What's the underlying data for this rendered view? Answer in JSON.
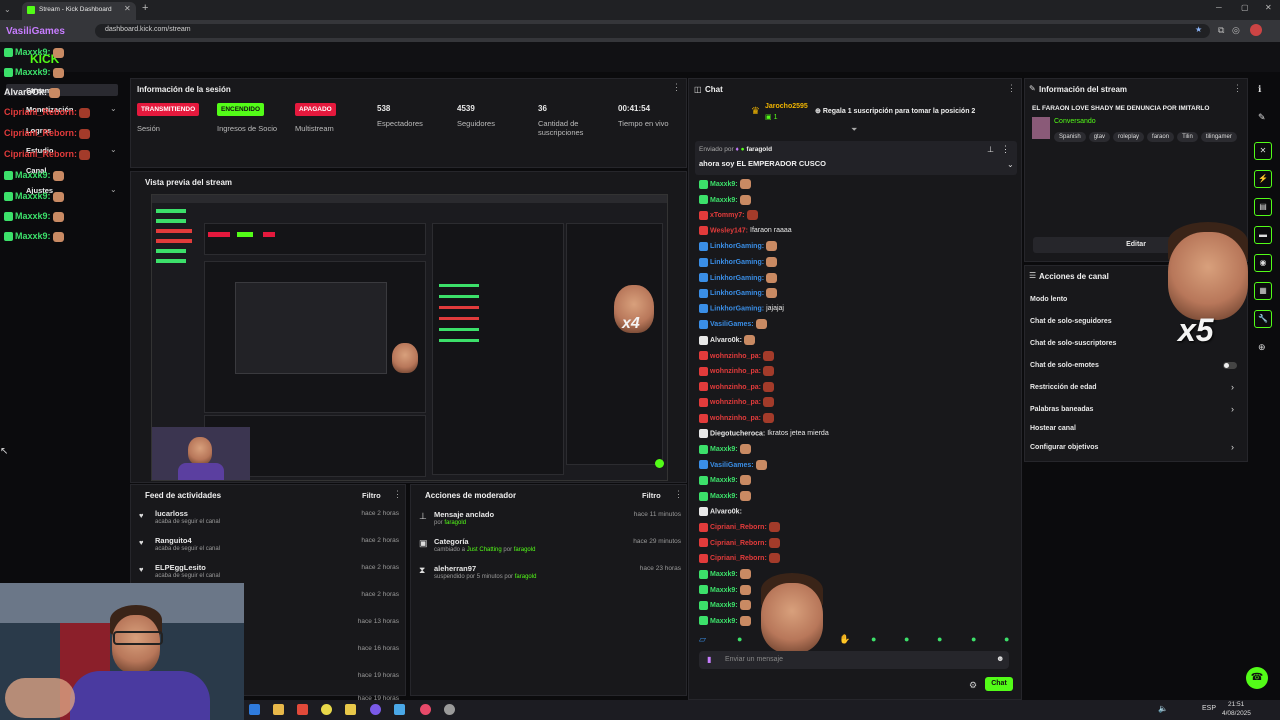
{
  "browser": {
    "tab_title": "Stream - Kick Dashboard",
    "new_tab_label": "+",
    "url": "dashboard.kick.com/stream"
  },
  "overlay": {
    "sidebar_chat_user": "VasiliGames",
    "kick_logo": "KICK"
  },
  "sidebar": {
    "overlay_users": [
      {
        "name": "Maxxk9:",
        "color": "#3ce06a"
      },
      {
        "name": "Maxxk9:",
        "color": "#3ce06a"
      },
      {
        "name": "AlvaroOk:",
        "color": "#e8e8e8"
      },
      {
        "name": "Cipriani_Reborn:",
        "color": "#e23b3b"
      },
      {
        "name": "Cipriani_Reborn:",
        "color": "#e23b3b"
      },
      {
        "name": "Cipriani_Reborn:",
        "color": "#e23b3b"
      },
      {
        "name": "Maxxk9:",
        "color": "#3ce06a"
      },
      {
        "name": "Maxxk9:",
        "color": "#3ce06a"
      },
      {
        "name": "Maxxk9:",
        "color": "#3ce06a"
      },
      {
        "name": "Maxxk9:",
        "color": "#3ce06a"
      }
    ],
    "items": [
      {
        "label": "Stream"
      },
      {
        "label": "Monetización"
      },
      {
        "label": "Logros"
      },
      {
        "label": "Estudio"
      },
      {
        "label": "Canal"
      },
      {
        "label": "Ajustes"
      }
    ]
  },
  "session": {
    "title": "Información de la sesión",
    "stats": [
      {
        "badge": "TRANSMITIENDO",
        "badge_color": "#e5193d",
        "label": "Sesión"
      },
      {
        "badge": "ENCENDIDO",
        "badge_color": "#53fc18",
        "label": "Ingresos de Socio"
      },
      {
        "badge": "APAGADO",
        "badge_color": "#e5193d",
        "label": "Multistream"
      },
      {
        "value": "538",
        "label": "Espectadores"
      },
      {
        "value": "4539",
        "label": "Seguidores"
      },
      {
        "value": "36",
        "label": "Cantidad de suscripciones"
      },
      {
        "value": "00:41:54",
        "label": "Tiempo en vivo"
      }
    ]
  },
  "preview": {
    "title": "Vista previa del stream",
    "overlay_multiplier": "x4"
  },
  "activity": {
    "title": "Feed de actividades",
    "filter": "Filtro",
    "items": [
      {
        "user": "lucarloss",
        "desc": "acaba de seguir el canal",
        "time": "hace 2 horas"
      },
      {
        "user": "Ranguito4",
        "desc": "acaba de seguir el canal",
        "time": "hace 2 horas"
      },
      {
        "user": "ELPEggLesito",
        "desc": "acaba de seguir el canal",
        "time": "hace 2 horas"
      },
      {
        "user": "",
        "desc": "",
        "time": "hace 2 horas"
      },
      {
        "user": "",
        "desc": "",
        "time": "hace 13 horas"
      },
      {
        "user": "",
        "desc": "",
        "time": "hace 16 horas"
      },
      {
        "user": "",
        "desc": "",
        "time": "hace 19 horas"
      },
      {
        "user": "",
        "desc": "",
        "time": "hace 19 horas"
      }
    ]
  },
  "modactions": {
    "title": "Acciones de moderador",
    "filter": "Filtro",
    "items": [
      {
        "title": "Mensaje anclado",
        "sub_prefix": "por",
        "sub_user": "faragold",
        "time": "hace 11 minutos"
      },
      {
        "title": "Categoría",
        "sub_prefix": "cambiado a",
        "sub_cat": "Just Chatting",
        "sub_by": "por",
        "sub_user": "faragold",
        "time": "hace 29 minutos"
      },
      {
        "title": "aleherran97",
        "sub_prefix": "suspendido por 5 minutos por",
        "sub_user": "faragold",
        "time": "hace 23 horas"
      }
    ]
  },
  "chat": {
    "title": "Chat",
    "gift_user": "Jarocho2595",
    "gift_count": "1",
    "gift_text": "Regala 1 suscripción para tomar la posición 2",
    "pinned_label": "Enviado por",
    "pinned_user": "faragold",
    "pinned_text": "ahora soy EL EMPERADOR CUSCO",
    "messages": [
      {
        "user": "Maxxk9:",
        "color": "#3ce06a",
        "text": "",
        "emote": true
      },
      {
        "user": "Maxxk9:",
        "color": "#3ce06a",
        "text": "",
        "emote": true
      },
      {
        "user": "xTommy7:",
        "color": "#e23b3b",
        "text": "",
        "emote": true
      },
      {
        "user": "Wesley147:",
        "color": "#e23b3b",
        "text": "Ifaraon raaaa",
        "emote": false
      },
      {
        "user": "LinkhorGaming:",
        "color": "#3a8ee6",
        "text": "",
        "emote": true
      },
      {
        "user": "LinkhorGaming:",
        "color": "#3a8ee6",
        "text": "",
        "emote": true
      },
      {
        "user": "LinkhorGaming:",
        "color": "#3a8ee6",
        "text": "",
        "emote": true
      },
      {
        "user": "LinkhorGaming:",
        "color": "#3a8ee6",
        "text": "",
        "emote": true
      },
      {
        "user": "LinkhorGaming:",
        "color": "#3a8ee6",
        "text": "jajajaj",
        "emote": false
      },
      {
        "user": "VasiliGames:",
        "color": "#3a8ee6",
        "text": "",
        "emote": true
      },
      {
        "user": "Alvaro0k:",
        "color": "#e8e8e8",
        "text": "",
        "emote": true
      },
      {
        "user": "wohnzinho_pa:",
        "color": "#e23b3b",
        "text": "",
        "emote": true
      },
      {
        "user": "wohnzinho_pa:",
        "color": "#e23b3b",
        "text": "",
        "emote": true
      },
      {
        "user": "wohnzinho_pa:",
        "color": "#e23b3b",
        "text": "",
        "emote": true
      },
      {
        "user": "wohnzinho_pa:",
        "color": "#e23b3b",
        "text": "",
        "emote": true
      },
      {
        "user": "wohnzinho_pa:",
        "color": "#e23b3b",
        "text": "",
        "emote": true
      },
      {
        "user": "Diegotucheroca:",
        "color": "#e8e8e8",
        "text": "Ikratos jetea mierda",
        "emote": false
      },
      {
        "user": "Maxxk9:",
        "color": "#3ce06a",
        "text": "",
        "emote": true
      },
      {
        "user": "VasiliGames:",
        "color": "#3a8ee6",
        "text": "",
        "emote": true
      },
      {
        "user": "Maxxk9:",
        "color": "#3ce06a",
        "text": "",
        "emote": true
      },
      {
        "user": "Maxxk9:",
        "color": "#3ce06a",
        "text": "",
        "emote": true
      },
      {
        "user": "Alvaro0k:",
        "color": "#e8e8e8",
        "text": "",
        "emote": false
      },
      {
        "user": "Cipriani_Reborn:",
        "color": "#e23b3b",
        "text": "",
        "emote": true
      },
      {
        "user": "Cipriani_Reborn:",
        "color": "#e23b3b",
        "text": "",
        "emote": true
      },
      {
        "user": "Cipriani_Reborn:",
        "color": "#e23b3b",
        "text": "",
        "emote": true
      },
      {
        "user": "Maxxk9:",
        "color": "#3ce06a",
        "text": "",
        "emote": true
      },
      {
        "user": "Maxxk9:",
        "color": "#3ce06a",
        "text": "",
        "emote": true
      },
      {
        "user": "Maxxk9:",
        "color": "#3ce06a",
        "text": "",
        "emote": true
      },
      {
        "user": "Maxxk9:",
        "color": "#3ce06a",
        "text": "",
        "emote": true
      }
    ],
    "input_placeholder": "Enviar un mensaje",
    "send_label": "Chat"
  },
  "stream_info": {
    "title": "Información del stream",
    "stream_title": "EL FARAON LOVE SHADY ME DENUNCIA POR IMITARLO",
    "category": "Conversando",
    "tags": [
      "Spanish",
      "gtav",
      "roleplay",
      "faraon",
      "Tilin",
      "tilingamer"
    ],
    "edit_label": "Editar"
  },
  "channel_actions": {
    "title": "Acciones de canal",
    "items": [
      {
        "label": "Modo lento",
        "control": "none"
      },
      {
        "label": "Chat de solo-seguidores",
        "control": "none"
      },
      {
        "label": "Chat de solo-suscriptores",
        "control": "none"
      },
      {
        "label": "Chat de solo-emotes",
        "control": "toggle"
      },
      {
        "label": "Restricción de edad",
        "control": "chevron"
      },
      {
        "label": "Palabras baneadas",
        "control": "chevron"
      },
      {
        "label": "Hostear canal",
        "control": "none"
      },
      {
        "label": "Configurar objetivos",
        "control": "chevron"
      }
    ],
    "overlay_multiplier": "x5"
  },
  "taskbar": {
    "lang": "ESP",
    "time": "21:51",
    "date": "4/08/2025"
  },
  "colors": {
    "kick_green": "#53fc18",
    "live_red": "#e5193d",
    "panel_bg": "#18181b"
  }
}
